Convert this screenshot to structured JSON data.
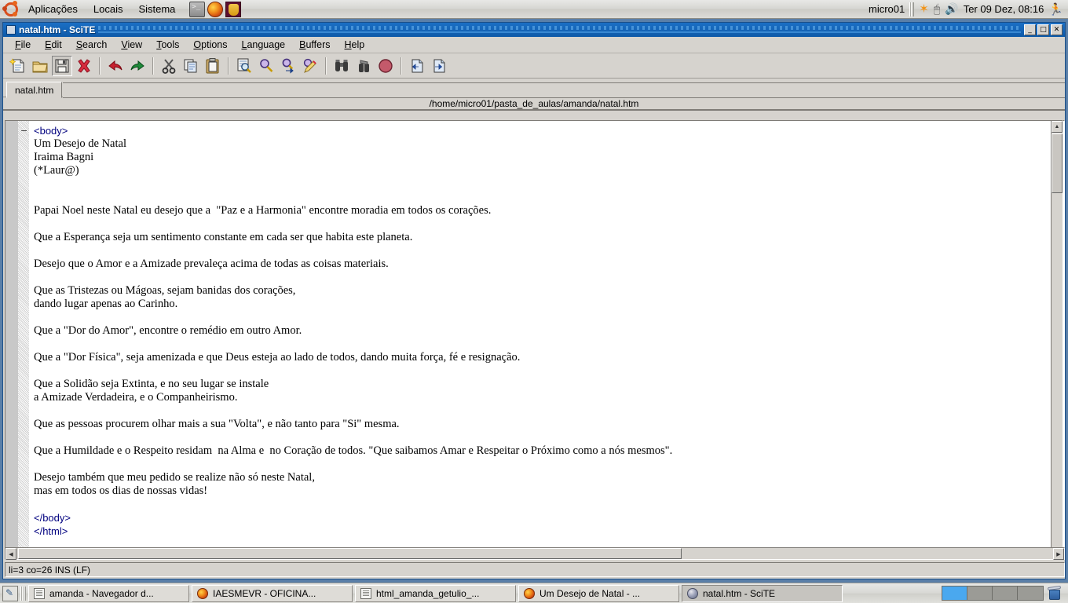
{
  "top_panel": {
    "menus": [
      "Aplicações",
      "Locais",
      "Sistema"
    ],
    "launchers": [
      "terminal-icon",
      "firefox-icon",
      "gold-app-icon"
    ],
    "host": "micro01",
    "tray_icons": [
      "alert-icon",
      "mouse-icon",
      "volume-icon",
      "runner-icon"
    ],
    "clock": "Ter 09 Dez, 08:16"
  },
  "window": {
    "title": "natal.htm - SciTE",
    "buttons": {
      "minimize": "_",
      "maximize": "□",
      "close": "✕"
    }
  },
  "menubar": [
    {
      "pre": "",
      "key": "F",
      "post": "ile"
    },
    {
      "pre": "",
      "key": "E",
      "post": "dit"
    },
    {
      "pre": "",
      "key": "S",
      "post": "earch"
    },
    {
      "pre": "",
      "key": "V",
      "post": "iew"
    },
    {
      "pre": "",
      "key": "T",
      "post": "ools"
    },
    {
      "pre": "",
      "key": "O",
      "post": "ptions"
    },
    {
      "pre": "",
      "key": "L",
      "post": "anguage"
    },
    {
      "pre": "",
      "key": "B",
      "post": "uffers"
    },
    {
      "pre": "",
      "key": "H",
      "post": "elp"
    }
  ],
  "toolbar": {
    "buttons": [
      "new-file-icon",
      "open-file-icon",
      "save-file-icon",
      "close-file-icon",
      "undo-icon",
      "redo-icon",
      "cut-icon",
      "copy-icon",
      "paste-icon",
      "find-icon",
      "find-next-icon",
      "find-in-files-icon",
      "replace-icon",
      "search-binoculars-icon",
      "build-icon",
      "stop-icon",
      "previous-bookmark-icon",
      "next-bookmark-icon"
    ]
  },
  "tabs": [
    {
      "label": "natal.htm",
      "active": true
    }
  ],
  "path": "/home/micro01/pasta_de_aulas/amanda/natal.htm",
  "editor": {
    "fold_marker": "−",
    "lines": [
      {
        "text": "<body>",
        "kind": "tag"
      },
      {
        "text": "Um Desejo de Natal",
        "kind": "txt"
      },
      {
        "text": "Iraima Bagni",
        "kind": "txt"
      },
      {
        "text": "(*Laur@)",
        "kind": "txt"
      },
      {
        "text": "",
        "kind": "blank"
      },
      {
        "text": "",
        "kind": "blank"
      },
      {
        "text": "Papai Noel neste Natal eu desejo que a  \"Paz e a Harmonia\" encontre moradia em todos os corações.",
        "kind": "txt"
      },
      {
        "text": "",
        "kind": "blank"
      },
      {
        "text": "Que a Esperança seja um sentimento constante em cada ser que habita este planeta.",
        "kind": "txt"
      },
      {
        "text": "",
        "kind": "blank"
      },
      {
        "text": "Desejo que o Amor e a Amizade prevaleça acima de todas as coisas materiais.",
        "kind": "txt"
      },
      {
        "text": "",
        "kind": "blank"
      },
      {
        "text": "Que as Tristezas ou Mágoas, sejam banidas dos corações,",
        "kind": "txt"
      },
      {
        "text": "dando lugar apenas ao Carinho.",
        "kind": "txt"
      },
      {
        "text": "",
        "kind": "blank"
      },
      {
        "text": "Que a \"Dor do Amor\", encontre o remédio em outro Amor.",
        "kind": "txt"
      },
      {
        "text": "",
        "kind": "blank"
      },
      {
        "text": "Que a \"Dor Física\", seja amenizada e que Deus esteja ao lado de todos, dando muita força, fé e resignação.",
        "kind": "txt"
      },
      {
        "text": "",
        "kind": "blank"
      },
      {
        "text": "Que a Solidão seja Extinta, e no seu lugar se instale",
        "kind": "txt"
      },
      {
        "text": "a Amizade Verdadeira, e o Companheirismo.",
        "kind": "txt"
      },
      {
        "text": "",
        "kind": "blank"
      },
      {
        "text": "Que as pessoas procurem olhar mais a sua \"Volta\", e não tanto para \"Si\" mesma.",
        "kind": "txt"
      },
      {
        "text": "",
        "kind": "blank"
      },
      {
        "text": "Que a Humildade e o Respeito residam  na Alma e  no Coração de todos. \"Que saibamos Amar e Respeitar o Próximo como a nós mesmos\".",
        "kind": "txt"
      },
      {
        "text": "",
        "kind": "blank"
      },
      {
        "text": "Desejo também que meu pedido se realize não só neste Natal,",
        "kind": "txt"
      },
      {
        "text": "mas em todos os dias de nossas vidas!",
        "kind": "txt"
      },
      {
        "text": "",
        "kind": "blank"
      },
      {
        "text": "</body>",
        "kind": "tag"
      },
      {
        "text": "</html>",
        "kind": "tag"
      }
    ]
  },
  "statusbar": "li=3 co=26 INS (LF)",
  "taskbar": {
    "tasks": [
      {
        "label": "amanda - Navegador d...",
        "icon": "doc",
        "active": false
      },
      {
        "label": "IAESMEVR - OFICINA...",
        "icon": "ff",
        "active": false
      },
      {
        "label": "html_amanda_getulio_...",
        "icon": "doc",
        "active": false
      },
      {
        "label": "Um Desejo de Natal - ...",
        "icon": "ff",
        "active": false
      },
      {
        "label": "natal.htm - SciTE",
        "icon": "scite",
        "active": true
      }
    ],
    "workspaces": [
      {
        "active": true
      },
      {
        "active": false
      },
      {
        "active": false
      },
      {
        "active": false
      }
    ],
    "trash": "trash-icon"
  },
  "colors": {
    "titlebar": "#1565b8",
    "tag_blue": "#00007f",
    "desktop": "#5a7fa8",
    "chrome": "#d6d3ce",
    "workspace_active": "#4aa8ef"
  }
}
